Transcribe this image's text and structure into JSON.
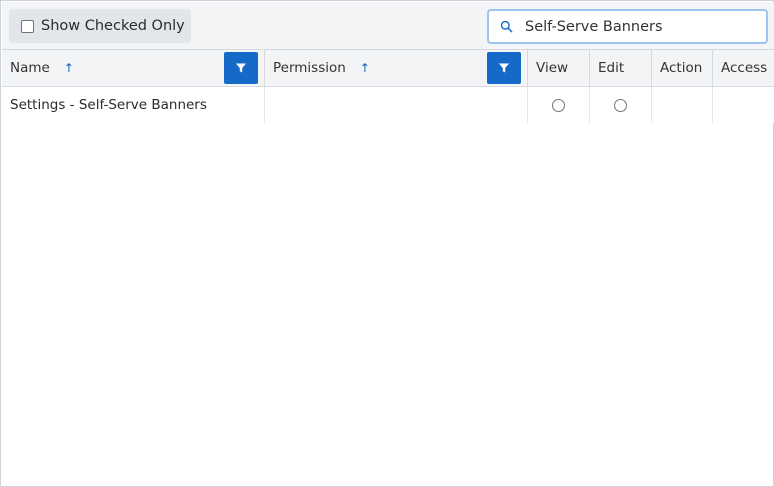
{
  "toolbar": {
    "show_checked_label": "Show Checked Only",
    "search_value": "Self-Serve Banners"
  },
  "columns": {
    "name": "Name",
    "permission": "Permission",
    "view": "View",
    "edit": "Edit",
    "action": "Action",
    "access": "Access"
  },
  "rows": [
    {
      "name": "Settings - Self-Serve Banners",
      "permission": ""
    }
  ],
  "icons": {
    "search": "search-icon",
    "filter": "filter-icon",
    "sort": "arrow-up-icon"
  },
  "colors": {
    "accent": "#1769c7",
    "search_focus_border": "#9cc4ef"
  }
}
